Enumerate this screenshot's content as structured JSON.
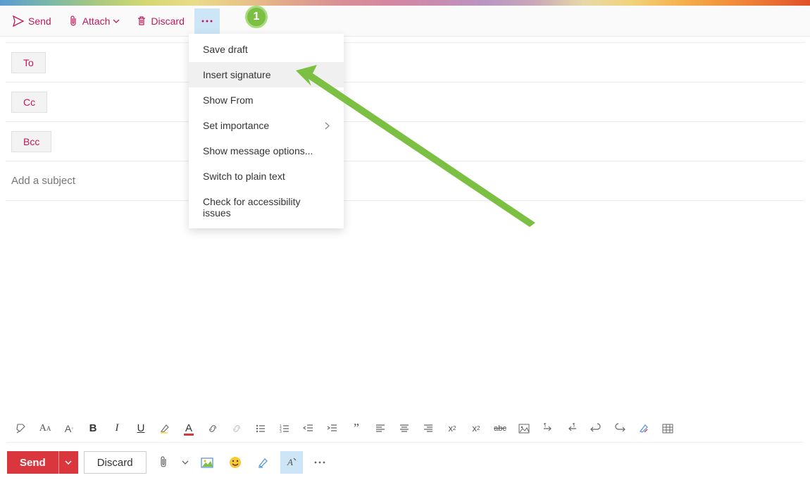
{
  "annotation": {
    "badge": "1"
  },
  "toolbar": {
    "send": "Send",
    "attach": "Attach",
    "discard": "Discard"
  },
  "menu": {
    "items": [
      {
        "label": "Save draft",
        "hasSubmenu": false
      },
      {
        "label": "Insert signature",
        "hasSubmenu": false,
        "hover": true
      },
      {
        "label": "Show From",
        "hasSubmenu": false
      },
      {
        "label": "Set importance",
        "hasSubmenu": true
      },
      {
        "label": "Show message options...",
        "hasSubmenu": false
      },
      {
        "label": "Switch to plain text",
        "hasSubmenu": false
      },
      {
        "label": "Check for accessibility issues",
        "hasSubmenu": false
      }
    ]
  },
  "fields": {
    "to": "To",
    "cc": "Cc",
    "bcc": "Bcc",
    "subject_placeholder": "Add a subject"
  },
  "bottom": {
    "send": "Send",
    "discard": "Discard"
  },
  "format_icons": {
    "paint": "paint-format-icon",
    "fontA": "font-face-icon",
    "fontSize": "font-size-icon",
    "bold": "B",
    "italic": "I",
    "underline": "U",
    "highlight": "highlight-icon",
    "fontcolor": "A",
    "link": "link-icon",
    "unlink": "unlink-icon",
    "bullets": "bullets-icon",
    "numbers": "numbers-icon",
    "outdent": "outdent-icon",
    "indent": "indent-icon",
    "quote": "quote-icon",
    "left": "align-left-icon",
    "center": "align-center-icon",
    "right": "align-right-icon",
    "sup": "x²",
    "sub": "x₂",
    "strike": "abc",
    "img": "insert-picture-icon",
    "ltr": "ltr-icon",
    "rtl": "rtl-icon",
    "undo": "undo-icon",
    "redo": "redo-icon",
    "clear": "clear-format-icon",
    "table": "table-icon"
  }
}
